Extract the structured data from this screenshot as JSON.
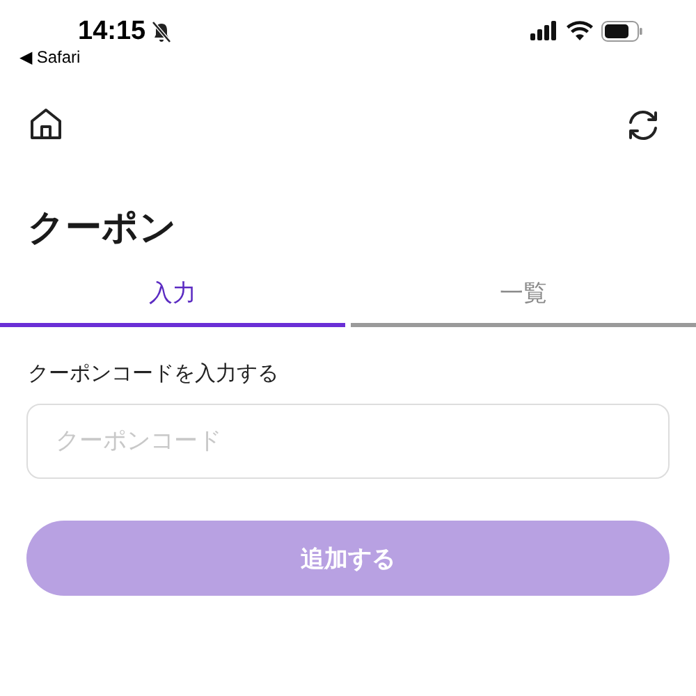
{
  "status_bar": {
    "time": "14:15",
    "silent": true,
    "back_app": "◀ Safari"
  },
  "title": "クーポン",
  "tabs": [
    {
      "label": "入力",
      "selected": true
    },
    {
      "label": "一覧",
      "selected": false
    }
  ],
  "form": {
    "label": "クーポンコードを入力する",
    "placeholder": "クーポンコード"
  },
  "submit": {
    "label": "追加する",
    "disabled": true
  }
}
